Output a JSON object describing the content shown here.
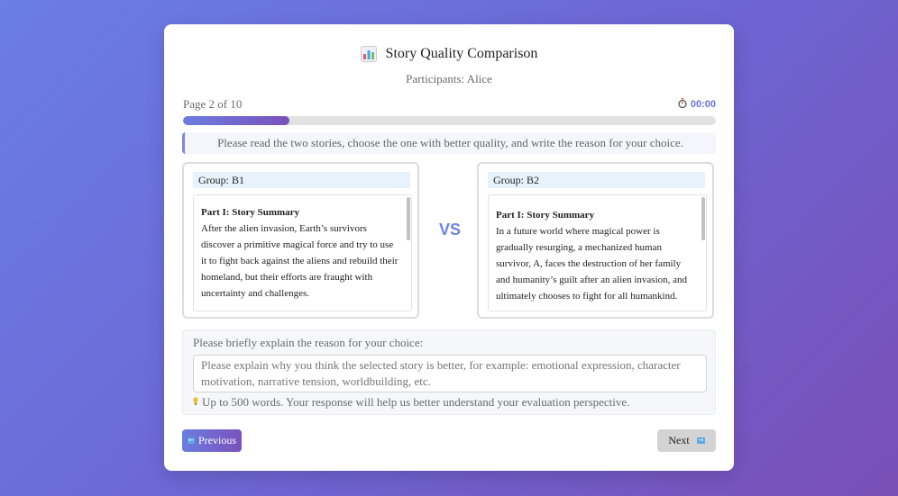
{
  "header": {
    "icon": "bar-chart-icon",
    "title": "Story Quality Comparison",
    "participants": "Participants: Alice"
  },
  "progress": {
    "page_text": "Page 2 of 10",
    "timer": "00:00",
    "timer_icon": "stopwatch-icon",
    "fraction": 0.2
  },
  "instructions": "Please read the two stories, choose the one with better quality, and write the reason for your choice.",
  "stories": {
    "left": {
      "group": "Group: B1",
      "heading": "Part I: Story Summary",
      "text": "After the alien invasion, Earth’s survivors discover a primitive magical force and try to use it to fight back against the aliens and rebuild their homeland, but their efforts are fraught with uncertainty and challenges."
    },
    "vs": "VS",
    "right": {
      "group": "Group: B2",
      "heading": "Part I: Story Summary",
      "text": "In a future world where magical power is gradually resurging, a mechanized human survivor, A, faces the destruction of her family and humanity’s guilt after an alien invasion, and ultimately chooses to fight for all humankind."
    }
  },
  "reason": {
    "label": "Please briefly explain the reason for your choice:",
    "placeholder": "Please explain why you think the selected story is better, for example: emotional expression, character motivation, narrative tension, worldbuilding, etc.",
    "value": "",
    "hint": "Up to 500 words. Your response will help us better understand your evaluation perspective.",
    "hint_icon": "lightbulb-icon"
  },
  "nav": {
    "previous_label": "Previous",
    "next_label": "Next"
  },
  "colors": {
    "accent_start": "#6b7de0",
    "accent_end": "#7a51bb",
    "vs": "#6f84e4",
    "group_bg": "#e7f2fd"
  }
}
